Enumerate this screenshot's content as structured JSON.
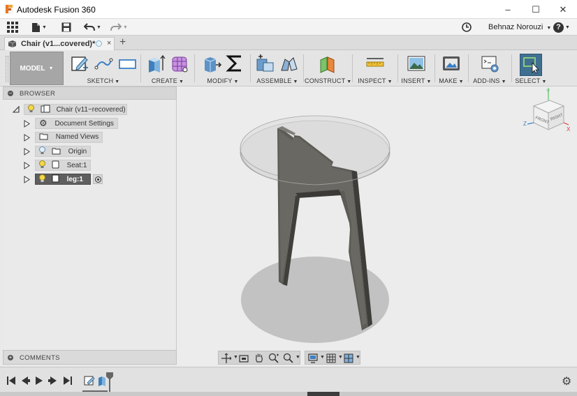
{
  "window": {
    "title": "Autodesk Fusion 360",
    "minimize": "–",
    "maximize": "☐",
    "close": "✕"
  },
  "qat": {
    "user": "Behnaz Norouzi",
    "help": "?"
  },
  "tab": {
    "label": "Chair (v1...covered)*",
    "close": "×",
    "add": "+"
  },
  "ribbon": {
    "workspace": "MODEL",
    "groups": [
      "SKETCH",
      "CREATE",
      "MODIFY",
      "ASSEMBLE",
      "CONSTRUCT",
      "INSPECT",
      "INSERT",
      "MAKE",
      "ADD-INS",
      "SELECT"
    ]
  },
  "browser": {
    "title": "BROWSER",
    "root": "Chair (v11~recovered)",
    "items": [
      "Document Settings",
      "Named Views",
      "Origin",
      "Seat:1",
      "leg:1"
    ]
  },
  "comments": {
    "title": "COMMENTS"
  },
  "viewcube": {
    "front": "FRONT",
    "right": "RIGHT",
    "axis_z": "Z",
    "axis_x": "X",
    "axis_y": "Y"
  },
  "colors": {
    "accent_blue": "#4a7fa8",
    "select_bg": "#3f6f91",
    "solid": "#5c5a55",
    "active_chip": "#5e5e5e"
  }
}
